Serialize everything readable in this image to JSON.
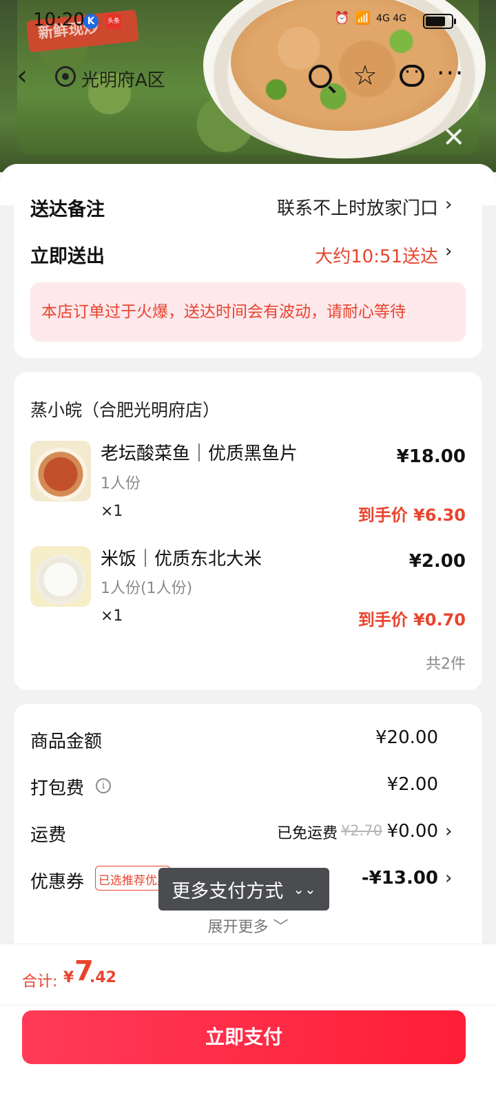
{
  "status_bar": {
    "time": "10:20",
    "app1": "K",
    "app2": "头条",
    "signal": "4G 4G"
  },
  "banner": {
    "promo_text": "新鲜现炒"
  },
  "nav": {
    "location": "光明府A区",
    "icons": [
      "back-icon",
      "location-icon",
      "search-icon",
      "star-icon",
      "chat-icon",
      "more-icon"
    ]
  },
  "delivery": {
    "note_label": "送达备注",
    "note_value": "联系不上时放家门口",
    "time_label": "立即送出",
    "time_value": "大约10:51送达",
    "notice": "本店订单过于火爆，送达时间会有波动，请耐心等待"
  },
  "order": {
    "store_name": "蒸小皖（合肥光明府店）",
    "items": [
      {
        "name": "老坛酸菜鱼｜优质黑鱼片",
        "spec": "1人份",
        "qty": "×1",
        "price": "¥18.00",
        "deal_price": "到手价 ¥6.30"
      },
      {
        "name": "米饭｜优质东北大米",
        "spec": "1人份(1人份)",
        "qty": "×1",
        "price": "¥2.00",
        "deal_price": "到手价 ¥0.70"
      }
    ],
    "total_count": "共2件"
  },
  "fees": {
    "goods_label": "商品金额",
    "goods_value": "¥20.00",
    "packing_label": "打包费",
    "packing_value": "¥2.00",
    "shipping_label": "运费",
    "shipping_free": "已免运费",
    "shipping_original": "¥2.70",
    "shipping_value": "¥0.00",
    "coupon_label": "优惠券",
    "coupon_tag": "已选推荐优惠",
    "coupon_value": "-¥13.00"
  },
  "toast": {
    "text": "更多支付方式"
  },
  "expand": {
    "text": "展开更多 ﹀"
  },
  "footer": {
    "total_label": "合计:",
    "currency": "¥",
    "total_int": "7",
    "total_dec": ".42",
    "pay_button": "立即支付"
  },
  "colors": {
    "accent_red": "#e8442d",
    "button_red": "#ff1e37",
    "notice_bg": "#fde8ec"
  }
}
